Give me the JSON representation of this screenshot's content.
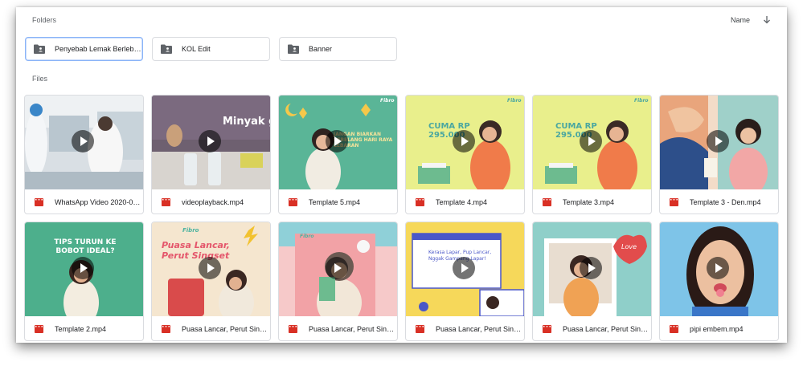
{
  "header": {
    "folders_label": "Folders",
    "sort_label": "Name",
    "files_label": "Files"
  },
  "folders": [
    {
      "name": "Penyebab Lemak Berlebih...",
      "selected": true
    },
    {
      "name": "KOL Edit",
      "selected": false
    },
    {
      "name": "Banner",
      "selected": false
    }
  ],
  "files": [
    {
      "name": "WhatsApp Video 2020-04...",
      "overlay": ""
    },
    {
      "name": "videoplayback.mp4",
      "overlay": "Minyak g"
    },
    {
      "name": "Template 5.mp4",
      "overlay": "JANGAN BIARKAN SEBELANG HARI RAYA LEBARAN",
      "brand": "Fibro"
    },
    {
      "name": "Template 4.mp4",
      "overlay": "CUMA RP 295.000",
      "brand": "Fibro"
    },
    {
      "name": "Template 3.mp4",
      "overlay": "CUMA RP 295.000",
      "brand": "Fibro"
    },
    {
      "name": "Template 3 - Den.mp4",
      "overlay": ""
    },
    {
      "name": "Template 2.mp4",
      "overlay": "TIPS TURUN KE BOBOT IDEAL?"
    },
    {
      "name": "Puasa Lancar, Perut Sings...",
      "overlay": "Puasa Lancar, Perut Singset",
      "brand": "Fibro"
    },
    {
      "name": "Puasa Lancar, Perut Sings...",
      "overlay": "",
      "brand": "Fibro"
    },
    {
      "name": "Puasa Lancar, Perut Sings...",
      "overlay": "Kerasa Lapar, Pup Lancar, Nggak Gampang Lapar!"
    },
    {
      "name": "Puasa Lancar, Perut Sings...",
      "overlay": "Love"
    },
    {
      "name": "pipi embem.mp4",
      "overlay": ""
    }
  ],
  "colors": {
    "folder_icon": "#5f6368",
    "video_icon": "#d93025",
    "selected_border": "#8ab4f8"
  }
}
